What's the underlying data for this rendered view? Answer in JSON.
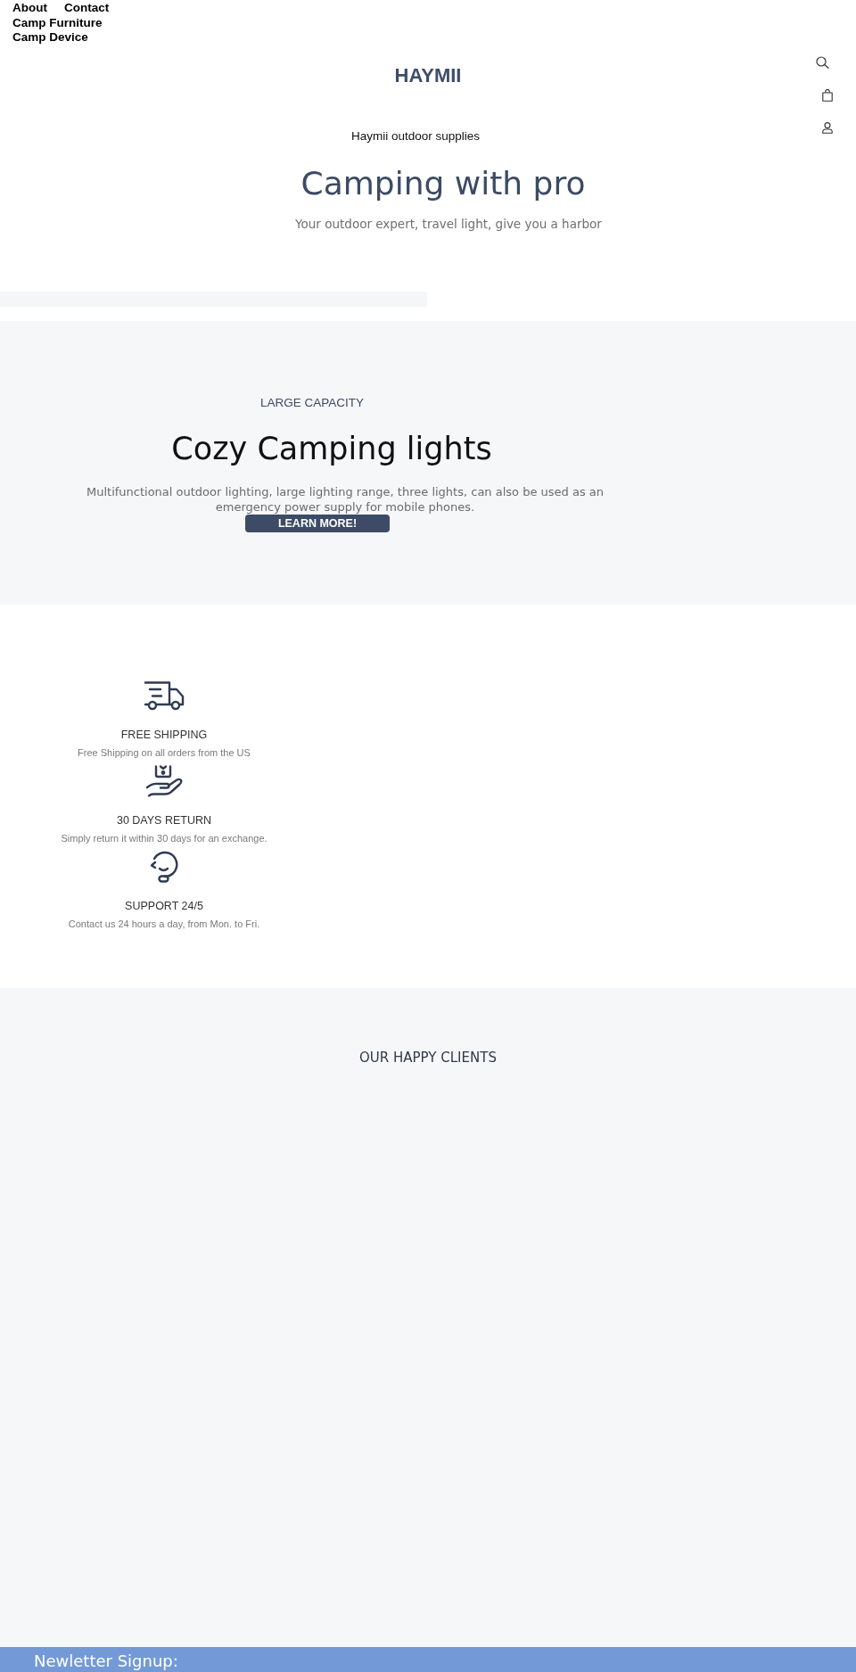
{
  "nav": {
    "links": [
      {
        "label": "About"
      },
      {
        "label": "Contact"
      },
      {
        "label": "Camp Furniture"
      },
      {
        "label": "Camp Device"
      }
    ]
  },
  "header": {
    "logo": "HAYMII"
  },
  "hero": {
    "eyebrow": "Haymii outdoor supplies",
    "title": "Camping with pro",
    "subtitle": "Your outdoor expert, travel light, give you a harbor"
  },
  "promo": {
    "eyebrow": "LARGE CAPACITY",
    "title": "Cozy Camping lights",
    "text": "Multifunctional outdoor lighting, large lighting range, three lights, can also be used as an emergency power supply for mobile phones.",
    "button": "LEARN MORE!"
  },
  "features": [
    {
      "kind": "shipping",
      "title": "FREE SHIPPING",
      "text": "Free Shipping on all orders from the US"
    },
    {
      "kind": "return",
      "title": "30 DAYS RETURN",
      "text": "Simply return it within 30 days for an exchange."
    },
    {
      "kind": "support",
      "title": "SUPPORT 24/5",
      "text": "Contact us 24 hours a day, from Mon. to Fri."
    }
  ],
  "testimonials": {
    "title": "OUR HAPPY CLIENTS"
  },
  "newsletter": {
    "title": "Newletter Signup:"
  }
}
